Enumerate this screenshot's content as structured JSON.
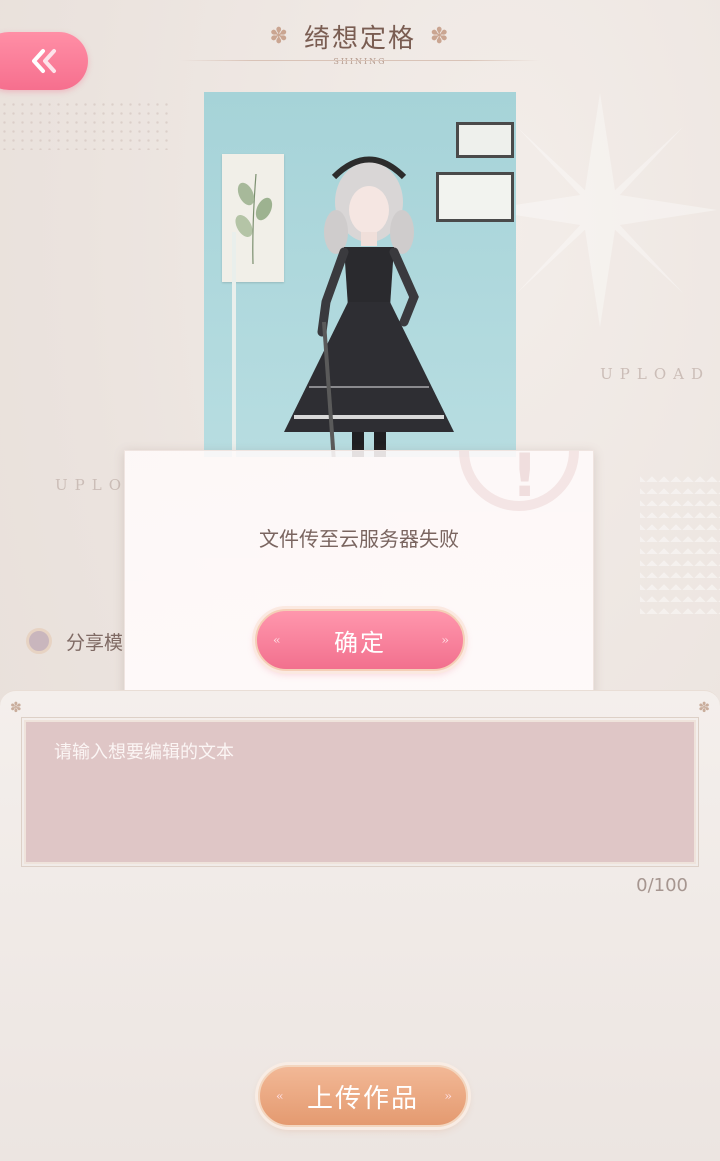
{
  "header": {
    "title": "绮想定格",
    "subtitle": "SHINING",
    "back_icon": "double-chevron-left-icon"
  },
  "background": {
    "upload_text_right": "UPLOAD",
    "upload_text_left": "UPLO"
  },
  "dialog": {
    "message": "文件传至云服务器失败",
    "confirm_label": "确定"
  },
  "share": {
    "label": "分享模"
  },
  "editor": {
    "placeholder": "请输入想要编辑的文本",
    "value": "",
    "counter": "0/100"
  },
  "upload_button": {
    "label": "上传作品"
  },
  "colors": {
    "accent_pink": "#f66f8e",
    "accent_orange": "#e49a70",
    "textarea_bg": "#dfc6c6"
  }
}
